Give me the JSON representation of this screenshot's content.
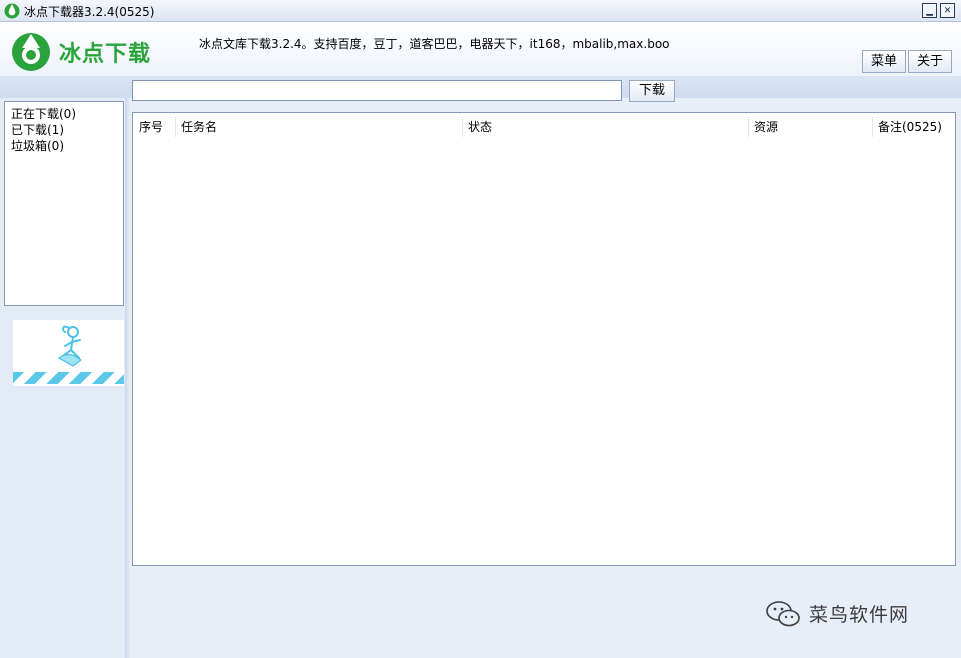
{
  "window": {
    "title": "冰点下载器3.2.4(0525)",
    "minimize_glyph": "▁",
    "close_glyph": "✕"
  },
  "header": {
    "logo_text": "冰点下载",
    "marquee": "冰点文库下载3.2.4。支持百度，豆丁，道客巴巴，电器天下，it168，mbalib,max.boo",
    "menu_label": "菜单",
    "about_label": "关于"
  },
  "search": {
    "placeholder": "",
    "value": "",
    "download_label": "下载"
  },
  "sidebar": {
    "items": [
      {
        "label": "正在下载(0)"
      },
      {
        "label": "已下载(1)"
      },
      {
        "label": "垃圾箱(0)"
      }
    ]
  },
  "table": {
    "columns": [
      "序号",
      "任务名",
      "状态",
      "资源",
      "备注(0525)"
    ],
    "rows": []
  },
  "watermark": {
    "text": "菜鸟软件网"
  },
  "colors": {
    "brand_green": "#2aa33c",
    "mascot_cyan": "#5cc8e8",
    "panel_bg": "#e3ebf7"
  }
}
